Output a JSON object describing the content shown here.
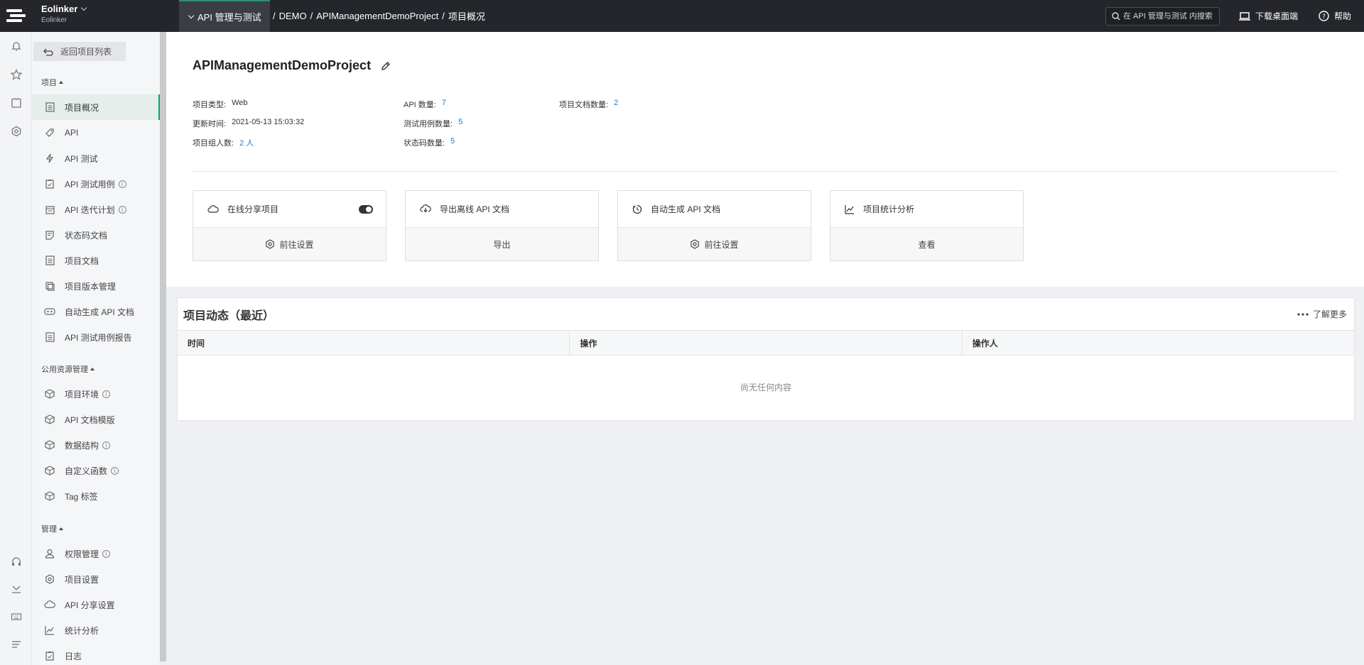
{
  "topbar": {
    "workspace_name": "Eolinker",
    "workspace_sub": "Eolinker",
    "module_tab": "API 管理与测试",
    "breadcrumb": [
      "DEMO",
      "APIManagementDemoProject",
      "项目概况"
    ],
    "search_placeholder": "在 API 管理与测试 内搜索",
    "download_label": "下载桌面端",
    "help_label": "帮助"
  },
  "rail": {
    "icons": [
      "bell-icon",
      "star-icon",
      "shirt-icon",
      "gear-icon",
      "headset-icon",
      "download-icon",
      "keyboard-icon",
      "menu-icon"
    ]
  },
  "sidebar": {
    "back_label": "返回项目列表",
    "groups": [
      {
        "title": "项目",
        "items": [
          {
            "label": "项目概况",
            "icon": "doc-icon",
            "active": true
          },
          {
            "label": "API",
            "icon": "tag-icon"
          },
          {
            "label": "API 测试",
            "icon": "lightning-icon"
          },
          {
            "label": "API 测试用例",
            "icon": "clipboard-icon",
            "info": true
          },
          {
            "label": "API 迭代计划",
            "icon": "calendar-icon",
            "info": true
          },
          {
            "label": "状态码文档",
            "icon": "note-icon"
          },
          {
            "label": "项目文档",
            "icon": "doc-icon"
          },
          {
            "label": "项目版本管理",
            "icon": "copy-icon"
          },
          {
            "label": "自动生成 API 文档",
            "icon": "robot-icon"
          },
          {
            "label": "API 测试用例报告",
            "icon": "report-icon"
          }
        ]
      },
      {
        "title": "公用资源管理",
        "items": [
          {
            "label": "项目环境",
            "icon": "cube-icon",
            "info": true
          },
          {
            "label": "API 文档模版",
            "icon": "cube-icon"
          },
          {
            "label": "数据结构",
            "icon": "cube-icon",
            "info": true
          },
          {
            "label": "自定义函数",
            "icon": "cube-icon",
            "info": true
          },
          {
            "label": "Tag 标签",
            "icon": "cube-icon"
          }
        ]
      },
      {
        "title": "管理",
        "items": [
          {
            "label": "权限管理",
            "icon": "user-icon",
            "info": true
          },
          {
            "label": "项目设置",
            "icon": "gear-icon"
          },
          {
            "label": "API 分享设置",
            "icon": "cloud-icon"
          },
          {
            "label": "统计分析",
            "icon": "chart-icon"
          },
          {
            "label": "日志",
            "icon": "clipboard-icon"
          }
        ]
      }
    ]
  },
  "project": {
    "name": "APIManagementDemoProject",
    "type_label": "项目类型:",
    "type_value": "Web",
    "updated_label": "更新时间:",
    "updated_value": "2021-05-13 15:03:32",
    "members_label": "项目组人数:",
    "members_value": "2 人",
    "api_count_label": "API 数量:",
    "api_count_value": "7",
    "test_cases_label": "测试用例数量:",
    "test_cases_value": "5",
    "status_codes_label": "状态码数量:",
    "status_codes_value": "5",
    "docs_label": "项目文档数量:",
    "docs_value": "2"
  },
  "cards": [
    {
      "title": "在线分享项目",
      "icon": "cloud-icon",
      "action": "前往设置",
      "action_icon": "gear-icon",
      "toggle": true
    },
    {
      "title": "导出离线 API 文档",
      "icon": "cloud-download-icon",
      "action": "导出"
    },
    {
      "title": "自动生成 API 文档",
      "icon": "timer-icon",
      "action": "前往设置",
      "action_icon": "gear-icon"
    },
    {
      "title": "项目统计分析",
      "icon": "chart-icon",
      "action": "查看"
    }
  ],
  "activity": {
    "title": "项目动态（最近）",
    "more_label": "了解更多",
    "columns": [
      "时间",
      "操作",
      "操作人"
    ],
    "empty_text": "尚无任何内容"
  }
}
